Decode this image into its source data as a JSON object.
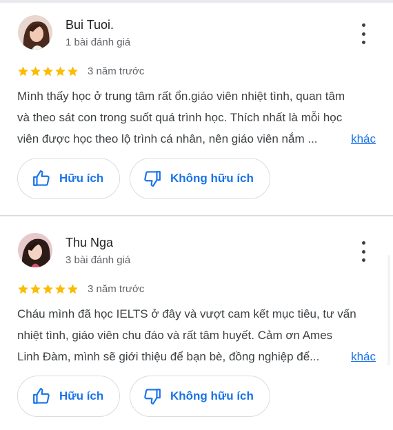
{
  "reviews": [
    {
      "author": "Bui Tuoi.",
      "review_count": "1 bài đánh giá",
      "rating": 5,
      "date": "3 năm trước",
      "lines": [
        "Mình thấy học ở trung tâm rất ổn.giáo viên nhiệt tình, quan tâm",
        "và theo sát con trong suốt quá trình học. Thích nhất là mỗi học",
        "viên được học theo lộ trình cá nhân, nên giáo viên nắm ..."
      ],
      "more_label": "khác",
      "helpful_label": "Hữu ích",
      "unhelpful_label": "Không hữu ích"
    },
    {
      "author": "Thu Nga",
      "review_count": "3 bài đánh giá",
      "rating": 5,
      "date": "3 năm trước",
      "lines": [
        "Cháu mình đã học IELTS ở đây và vượt cam kết mục tiêu, tư vấn",
        "nhiệt tình, giáo viên chu đáo và rất tâm huyết. Cảm ơn Ames",
        "Linh Đàm, mình sẽ giới thiệu để bạn bè, đồng nghiệp để..."
      ],
      "more_label": "khác",
      "helpful_label": "Hữu ích",
      "unhelpful_label": "Không hữu ích"
    }
  ],
  "colors": {
    "star": "#fbbc04",
    "link": "#1a73e8",
    "secondary_text": "#5f6368"
  },
  "icons": [
    "more-vert-icon",
    "thumb-up-icon",
    "thumb-down-icon",
    "star-icon"
  ]
}
